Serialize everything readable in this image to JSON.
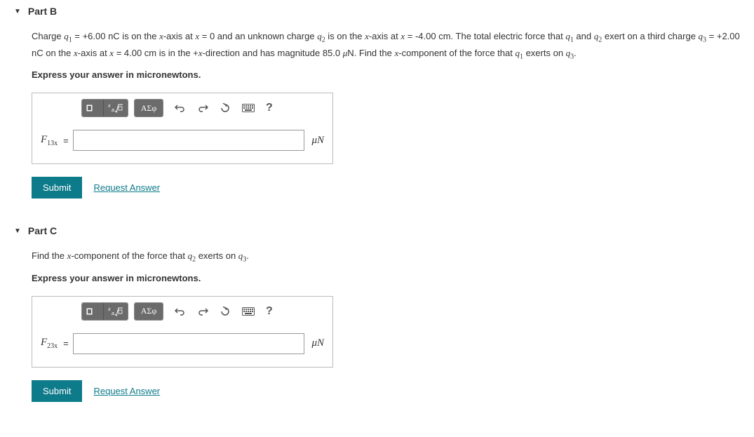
{
  "partB": {
    "title": "Part B",
    "problem_html": "Charge <span class='math'>q<sub>1</sub></span> = +6.00 nC is on the <span class='math'>x</span>-axis at <span class='math'>x</span> = 0 and an unknown charge <span class='math'>q<sub>2</sub></span> is on the <span class='math'>x</span>-axis at <span class='math'>x</span> = -4.00 cm. The total electric force that <span class='math'>q<sub>1</sub></span> and <span class='math'>q<sub>2</sub></span> exert on a third charge <span class='math'>q<sub>3</sub></span> = +2.00 nC on the <span class='math'>x</span>-axis at <span class='math'>x</span> = 4.00 cm is in the +<span class='math'>x</span>-direction and has magnitude 85.0 <span class='math'>μ</span>N. Find the <span class='math'>x</span>-component of the force that <span class='math'>q<sub>1</sub></span> exerts on <span class='math'>q<sub>3</sub></span>.",
    "instruction": "Express your answer in micronewtons.",
    "lhs_html": "F<sub>13x</sub>",
    "unit": "μN",
    "value": ""
  },
  "partC": {
    "title": "Part C",
    "problem_html": "Find the <span class='math'>x</span>-component of the force that <span class='math'>q<sub>2</sub></span> exerts on <span class='math'>q<sub>3</sub></span>.",
    "instruction": "Express your answer in micronewtons.",
    "lhs_html": "F<sub>23x</sub>",
    "unit": "μN",
    "value": ""
  },
  "toolbar": {
    "templates": "■",
    "fraction": "√",
    "sup": "□",
    "greek": "ΑΣφ",
    "help": "?"
  },
  "actions": {
    "submit": "Submit",
    "request": "Request Answer"
  }
}
